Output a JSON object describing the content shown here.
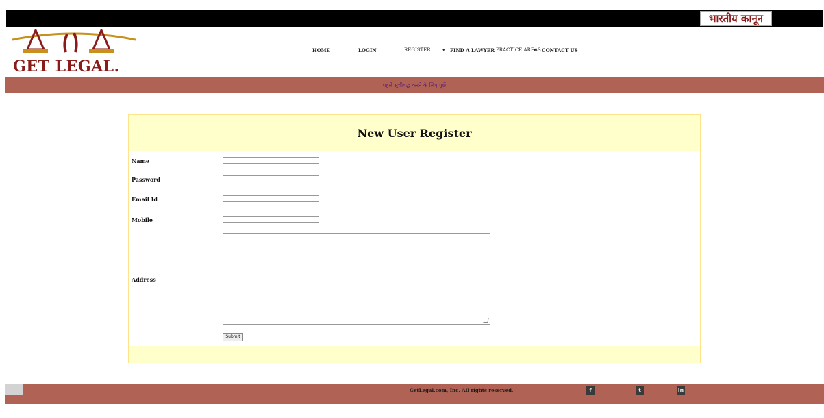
{
  "header": {
    "badge_text": "भारतीय कानून",
    "logo_text": "GET LEGAL.",
    "nav": [
      {
        "label": "HOME"
      },
      {
        "label": "LOGIN"
      },
      {
        "label": "REGISTER"
      },
      {
        "label": "FIND A LAWYER",
        "caret": "▾"
      },
      {
        "label": "PRACTICE AREAS",
        "caret": "▾"
      },
      {
        "label": "CONTACT US"
      }
    ]
  },
  "banner": {
    "link_text": "पहले सूचीबद्ध करने के लिए पूछें"
  },
  "form": {
    "title": "New User Register",
    "fields": {
      "name_label": "Name",
      "password_label": "Password",
      "email_label": "Email Id",
      "mobile_label": "Mobile",
      "address_label": "Address"
    },
    "values": {
      "name": "",
      "password": "",
      "email": "",
      "mobile": "",
      "address": ""
    },
    "submit_label": "Submit"
  },
  "footer": {
    "copyright": "GetLegal.com, Inc. All rights reserved.",
    "social": [
      {
        "icon": "facebook-icon",
        "glyph": "f"
      },
      {
        "icon": "twitter-icon",
        "glyph": "t"
      },
      {
        "icon": "linkedin-icon",
        "glyph": "in"
      }
    ]
  },
  "colors": {
    "brand_red": "#b06354",
    "logo_red": "#8b1a1a",
    "logo_gold": "#c8901c",
    "panel_yellow": "#ffffcc"
  }
}
